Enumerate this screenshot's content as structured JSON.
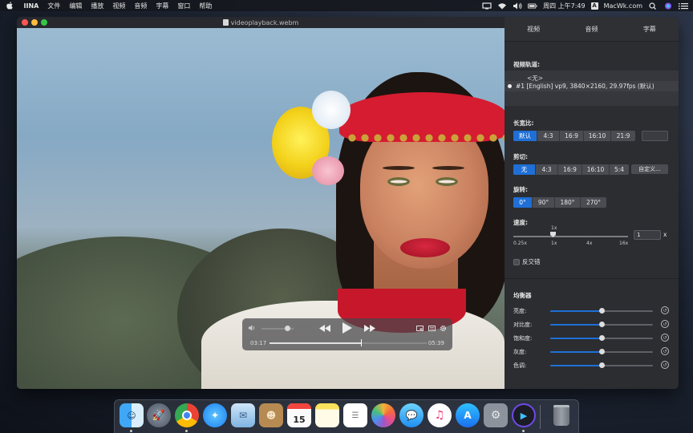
{
  "menubar": {
    "app_name": "IINA",
    "items": [
      "文件",
      "编辑",
      "播放",
      "视频",
      "音频",
      "字幕",
      "窗口",
      "帮助"
    ],
    "clock": "周四 上午7:49",
    "input_label": "A",
    "site": "MacWk.com"
  },
  "window": {
    "title": "videoplayback.webm"
  },
  "osc": {
    "current_time": "03:17",
    "total_time": "05:39",
    "progress": 0.58,
    "volume": 0.8
  },
  "sidebar": {
    "tabs": [
      "视频",
      "音频",
      "字幕"
    ],
    "video_track_label": "视频轨道:",
    "track_none": "<无>",
    "track_selected": "#1  [English] vp9, 3840×2160, 29.97fps (默认)",
    "aspect_label": "长宽比:",
    "aspect_options": [
      "默认",
      "4:3",
      "16:9",
      "16:10",
      "21:9"
    ],
    "aspect_selected": 0,
    "crop_label": "剪切:",
    "crop_options": [
      "无",
      "4:3",
      "16:9",
      "16:10",
      "5:4"
    ],
    "crop_selected": 0,
    "crop_custom": "自定义...",
    "rotate_label": "旋转:",
    "rotate_options": [
      "0°",
      "90°",
      "180°",
      "270°"
    ],
    "rotate_selected": 0,
    "speed_label": "速度:",
    "speed_current_tick": "1x",
    "speed_ticks": [
      "0.25x",
      "1x",
      "4x",
      "16x"
    ],
    "speed_value": "1",
    "speed_unit": "x",
    "deinterlace_label": "反交错",
    "equalizer_label": "均衡器",
    "equalizer": [
      {
        "label": "亮度:",
        "value": 0.5
      },
      {
        "label": "对比度:",
        "value": 0.5
      },
      {
        "label": "饱和度:",
        "value": 0.5
      },
      {
        "label": "灰度:",
        "value": 0.5
      },
      {
        "label": "色调:",
        "value": 0.5
      }
    ]
  },
  "dock": {
    "calendar_day": "15",
    "icons": [
      "finder-icon",
      "launchpad-icon",
      "chrome-icon",
      "safari-icon",
      "mail-icon",
      "contacts-icon",
      "calendar-icon",
      "notes-icon",
      "reminders-icon",
      "photos-icon",
      "messages-icon",
      "itunes-icon",
      "app-store-icon",
      "system-preferences-icon",
      "iina-icon",
      "trash-icon"
    ]
  }
}
